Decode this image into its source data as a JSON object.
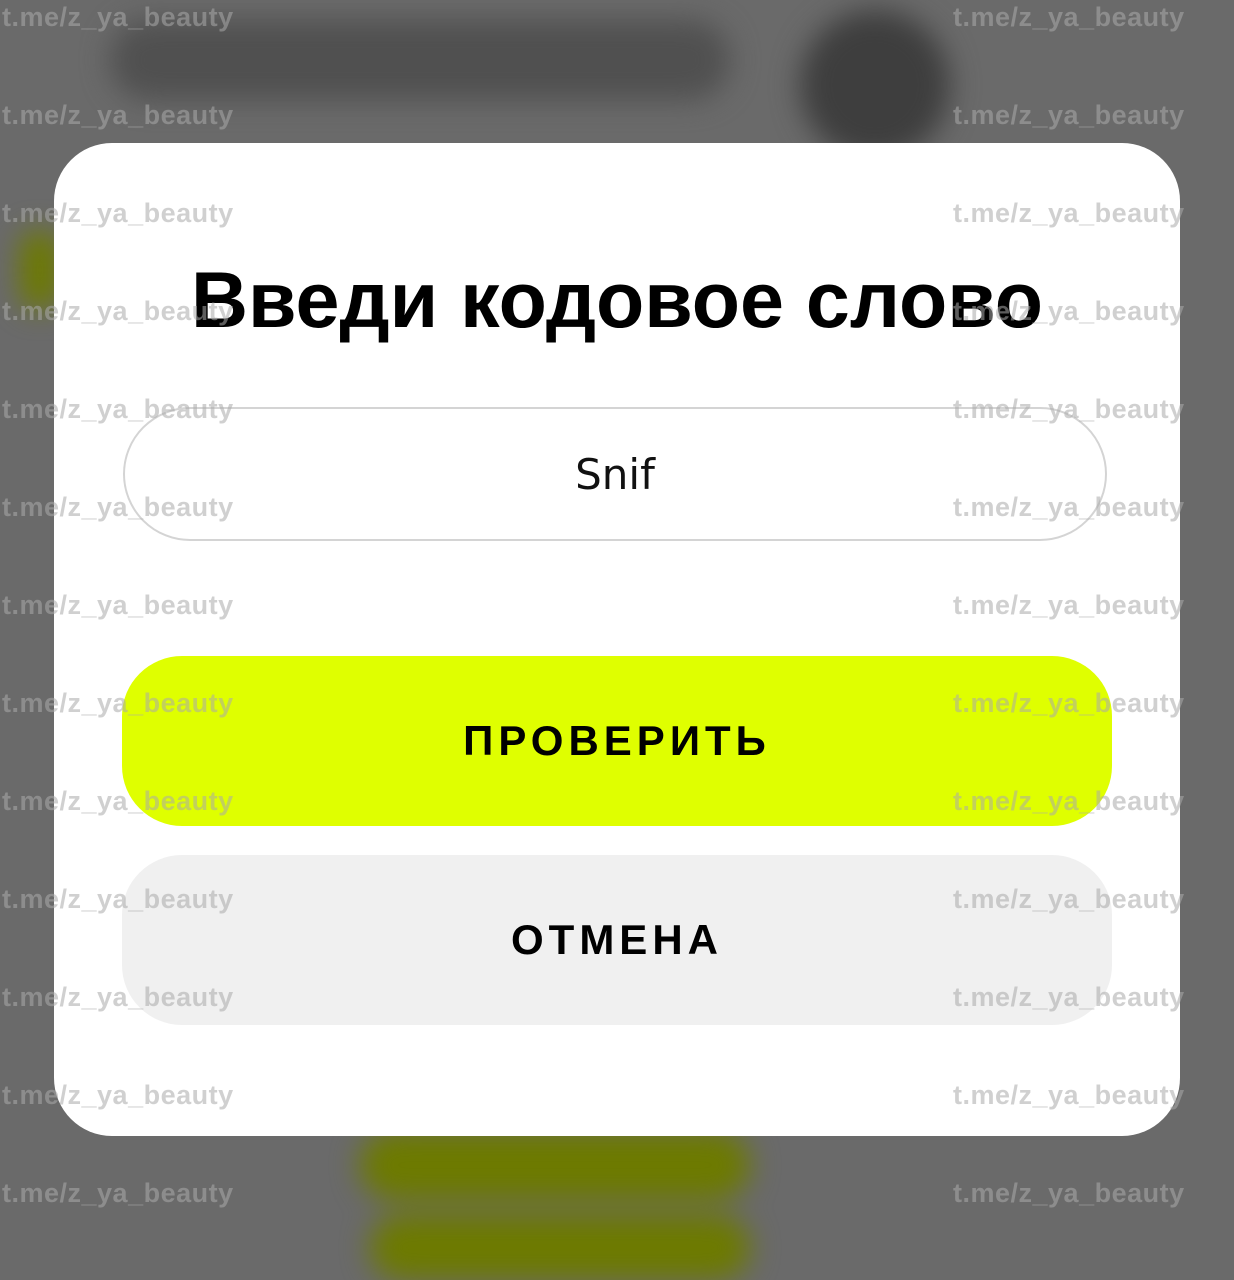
{
  "dialog": {
    "title": "Введи кодовое слово",
    "input_value": "Snif",
    "check_label": "ПРОВЕРИТЬ",
    "cancel_label": "ОТМЕНА"
  },
  "watermark": {
    "text": "t.me/z_ya_beauty"
  },
  "colors": {
    "accent": "#dfff00",
    "cancel_bg": "#f0f0f0",
    "overlay": "#6a6a6a"
  }
}
